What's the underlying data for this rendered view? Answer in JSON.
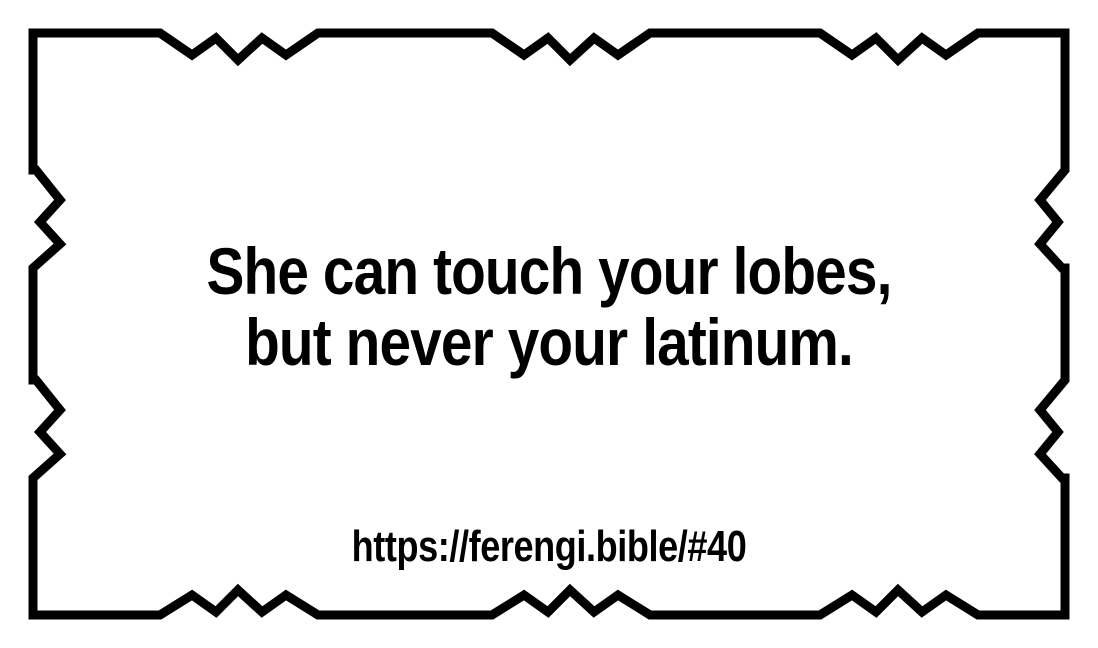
{
  "card": {
    "quote_line_1": "She can touch your lobes,",
    "quote_line_2": "but never your latinum.",
    "url": "https://ferengi.bible/#40"
  },
  "colors": {
    "background": "#ffffff",
    "border": "#000000",
    "text": "#000000"
  }
}
